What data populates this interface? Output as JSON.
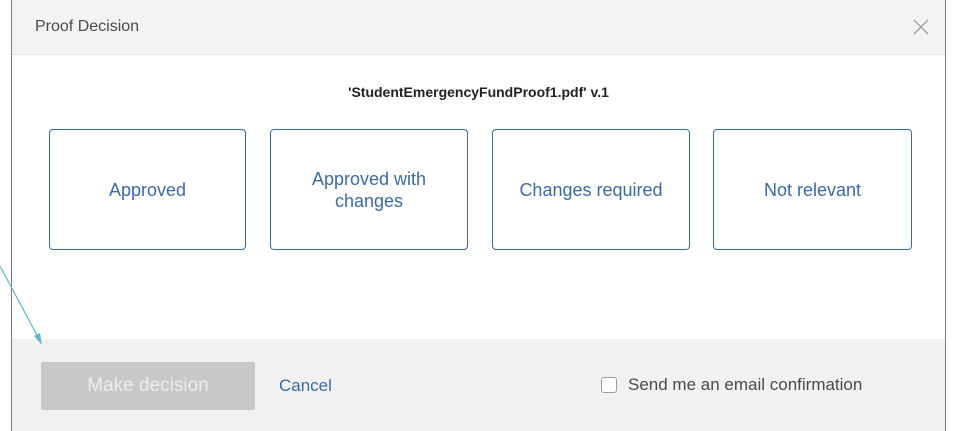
{
  "dialog": {
    "title": "Proof Decision",
    "close_icon": "close-icon"
  },
  "file": {
    "label": "'StudentEmergencyFundProof1.pdf' v.1"
  },
  "options": [
    {
      "label": "Approved"
    },
    {
      "label": "Approved with changes"
    },
    {
      "label": "Changes required"
    },
    {
      "label": "Not relevant"
    }
  ],
  "footer": {
    "make_decision_label": "Make decision",
    "cancel_label": "Cancel",
    "email_confirmation_label": "Send me an email confirmation",
    "email_confirmation_checked": false
  },
  "annotation": {
    "arrow_icon": "pointer-arrow-icon",
    "arrow_color": "#5bb8c8"
  },
  "colors": {
    "accent": "#3a6aa8",
    "disabled_button": "#c8c8c8",
    "header_bg": "#f3f3f3",
    "footer_bg": "#f1f1f1"
  }
}
